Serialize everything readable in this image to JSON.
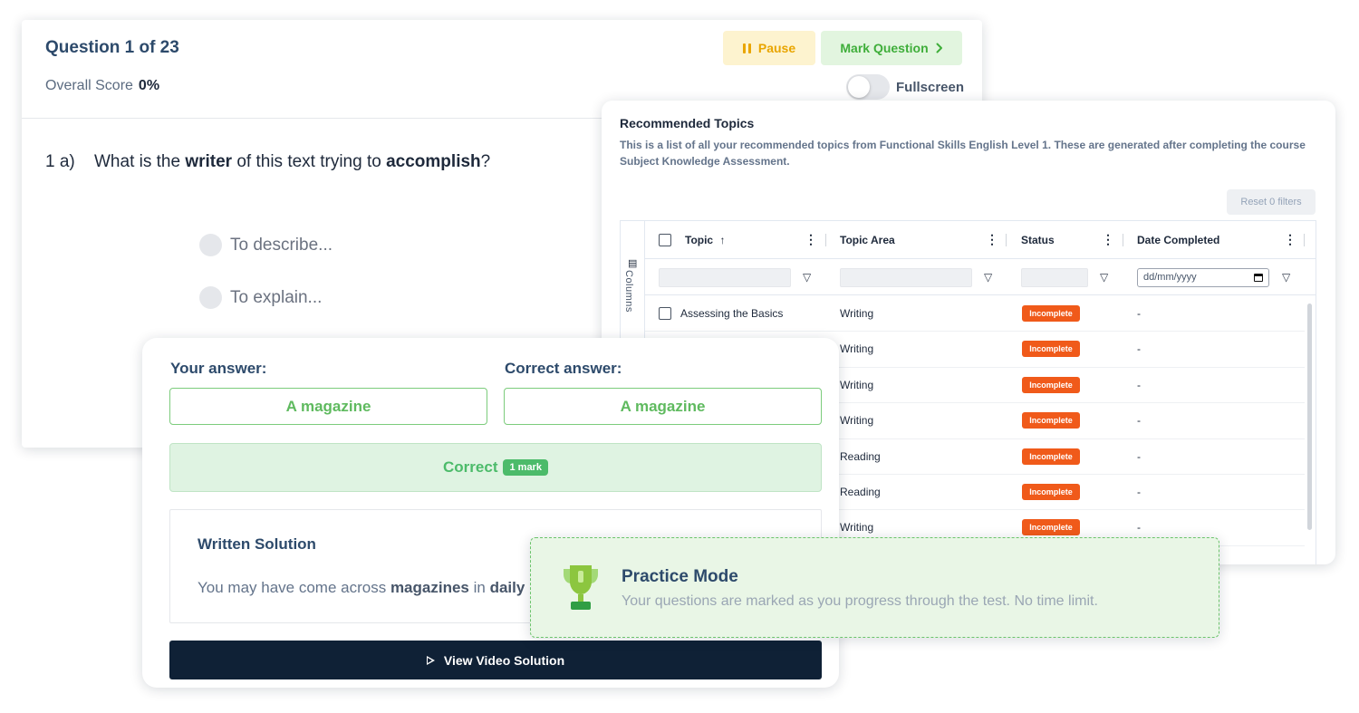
{
  "question": {
    "title": "Question 1 of 23",
    "score_label": "Overall Score",
    "score_value": "0%",
    "pause_label": "Pause",
    "mark_label": "Mark Question",
    "fullscreen_label": "Fullscreen",
    "number": "1 a)",
    "text_parts": [
      "What is the ",
      "writer",
      " of this text trying to ",
      "accomplish",
      "?"
    ],
    "options": [
      "To describe...",
      "To explain..."
    ]
  },
  "topics": {
    "title": "Recommended Topics",
    "description": "This is a list of all your recommended topics from Functional Skills English Level 1. These are generated after completing the course Subject Knowledge Assessment.",
    "reset_label": "Reset 0 filters",
    "columns_label": "Columns",
    "headers": [
      "Topic",
      "Topic Area",
      "Status",
      "Date Completed"
    ],
    "sort_indicator": "↑",
    "date_placeholder": "dd/mm/yyyy",
    "rows": [
      {
        "topic": "Assessing the Basics",
        "area": "Writing",
        "status": "Incomplete",
        "date": "-"
      },
      {
        "topic": "",
        "area": "Writing",
        "status": "Incomplete",
        "date": "-"
      },
      {
        "topic": "",
        "area": "Writing",
        "status": "Incomplete",
        "date": "-"
      },
      {
        "topic": "",
        "area": "Writing",
        "status": "Incomplete",
        "date": "-"
      },
      {
        "topic": "",
        "area": "Reading",
        "status": "Incomplete",
        "date": "-"
      },
      {
        "topic": "",
        "area": "Reading",
        "status": "Incomplete",
        "date": "-"
      },
      {
        "topic": "",
        "area": "Writing",
        "status": "Incomplete",
        "date": "-"
      }
    ],
    "status_color": "#f05a1a"
  },
  "answer": {
    "your_label": "Your answer:",
    "your_value": "A magazine",
    "correct_label": "Correct answer:",
    "correct_value": "A magazine",
    "result_text": "Correct",
    "mark_badge": "1 mark",
    "solution_title": "Written Solution",
    "solution_parts": [
      "You may have come across ",
      "magazines",
      " in ",
      "daily"
    ],
    "video_label": "View Video Solution"
  },
  "practice": {
    "title": "Practice Mode",
    "description": "Your questions are marked as you progress through the test. No time limit.",
    "icon": "trophy-icon"
  },
  "colors": {
    "accent_green": "#4cbb6a",
    "navy": "#0f2136",
    "pause_yellow": "#e9a500"
  }
}
